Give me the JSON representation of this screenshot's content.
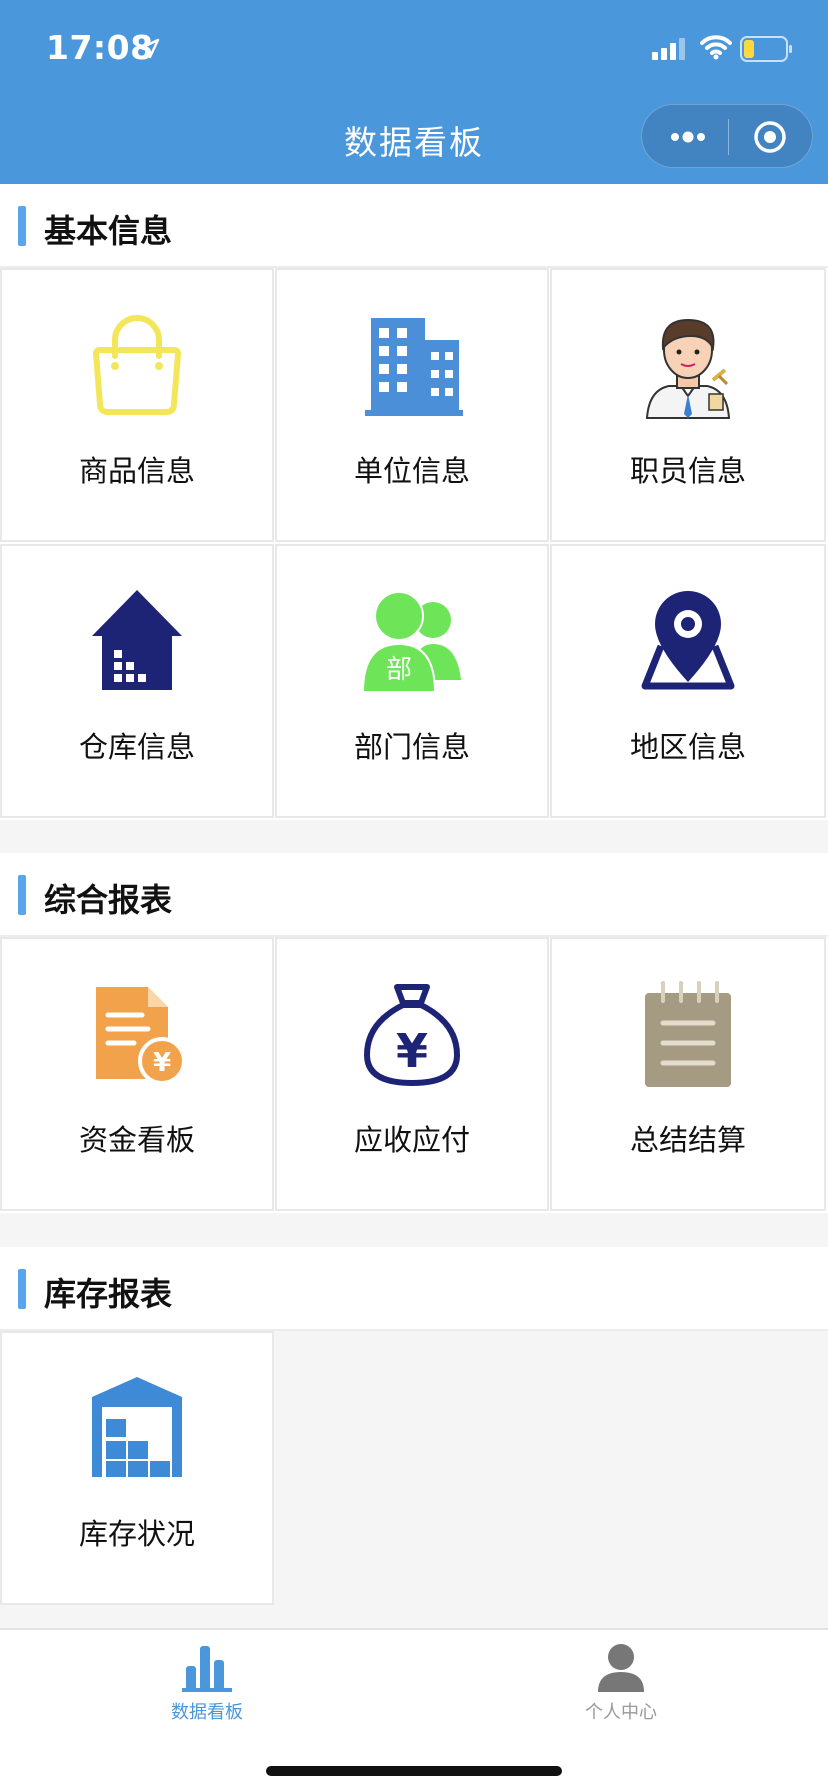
{
  "status_bar": {
    "time": "17:08"
  },
  "nav": {
    "title": "数据看板"
  },
  "sections": [
    {
      "title": "基本信息",
      "items": [
        {
          "label": "商品信息",
          "icon": "shopping-bag-icon"
        },
        {
          "label": "单位信息",
          "icon": "building-icon"
        },
        {
          "label": "职员信息",
          "icon": "employee-icon"
        },
        {
          "label": "仓库信息",
          "icon": "warehouse-house-icon"
        },
        {
          "label": "部门信息",
          "icon": "department-people-icon",
          "icon_text": "部"
        },
        {
          "label": "地区信息",
          "icon": "map-pin-icon"
        }
      ]
    },
    {
      "title": "综合报表",
      "items": [
        {
          "label": "资金看板",
          "icon": "fund-document-icon",
          "icon_text": "¥"
        },
        {
          "label": "应收应付",
          "icon": "money-bag-icon",
          "icon_text": "¥"
        },
        {
          "label": "总结结算",
          "icon": "notepad-icon"
        }
      ]
    },
    {
      "title": "库存报表",
      "items": [
        {
          "label": "库存状况",
          "icon": "inventory-warehouse-icon"
        }
      ]
    }
  ],
  "tab_bar": {
    "items": [
      {
        "label": "数据看板",
        "icon": "bar-chart-icon",
        "active": true
      },
      {
        "label": "个人中心",
        "icon": "user-icon",
        "active": false
      }
    ]
  },
  "colors": {
    "brand_blue": "#4a97dc",
    "accent_bar": "#5aa6ee",
    "tab_active": "#4a97dc",
    "tab_inactive": "#999999"
  }
}
